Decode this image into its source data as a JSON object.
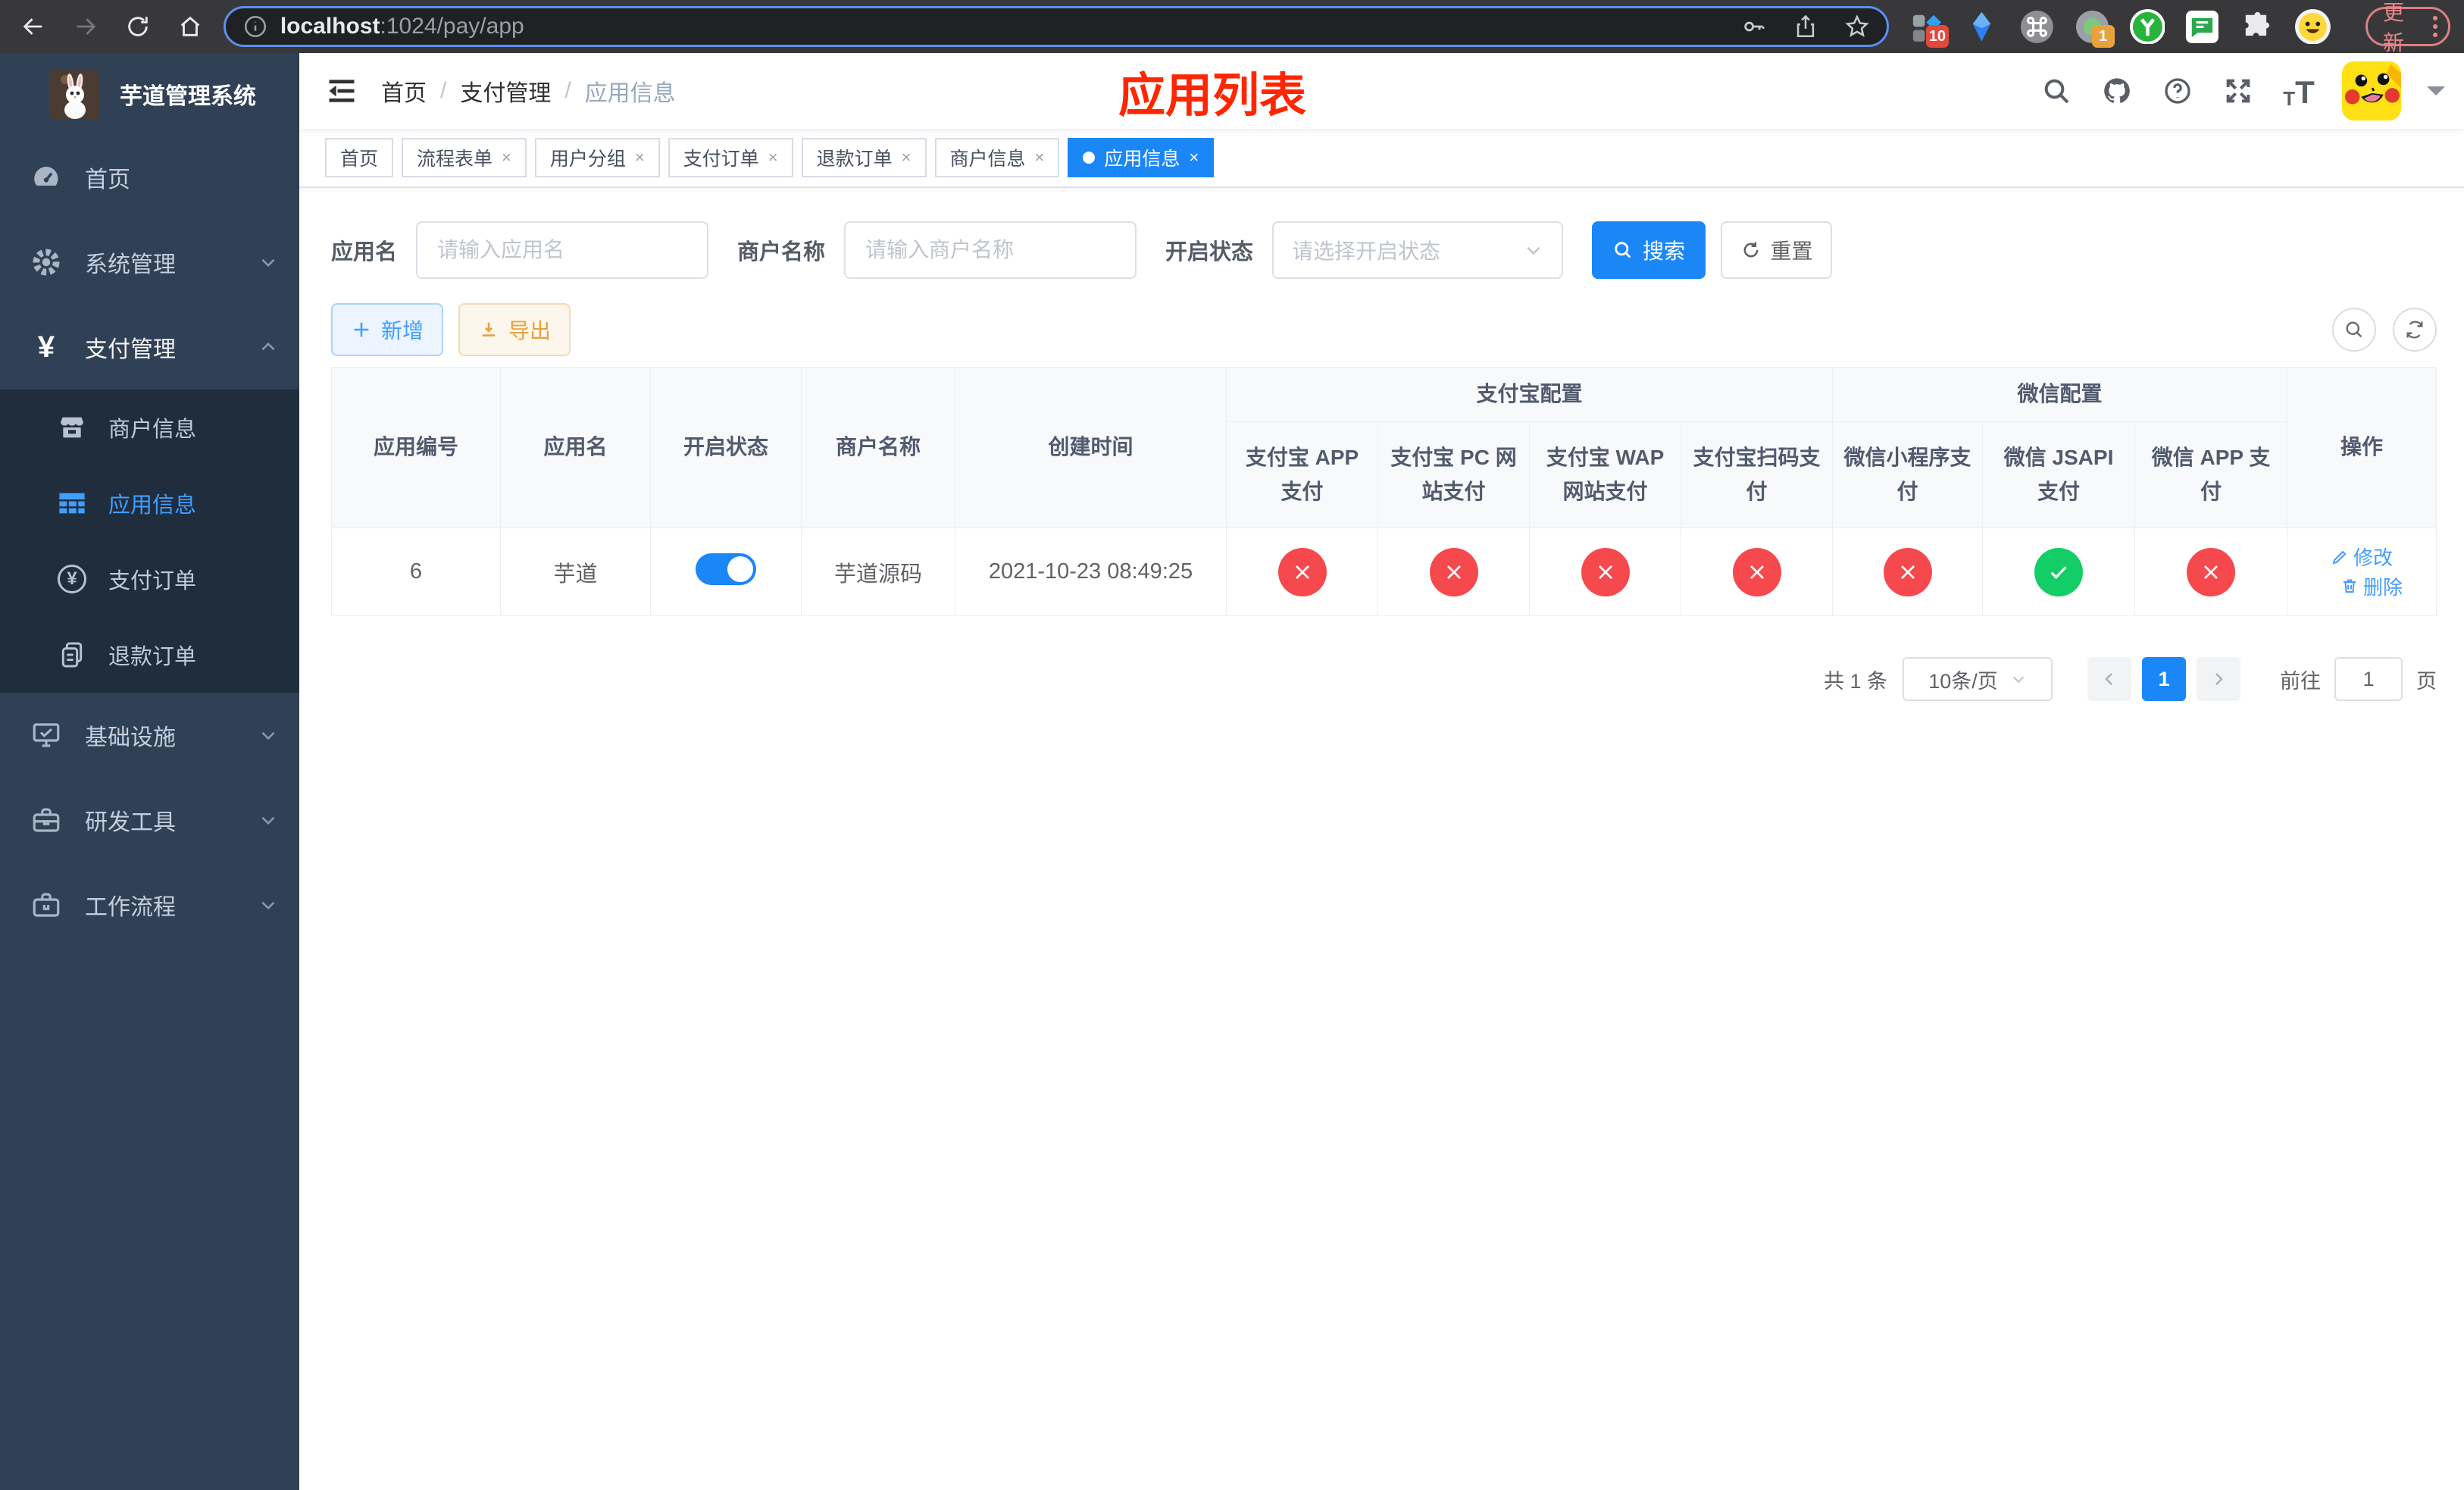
{
  "browser": {
    "url_host": "localhost",
    "url_path": ":1024/pay/app",
    "update_button": "更新",
    "ext_badge_a": "10",
    "ext_badge_b": "1"
  },
  "sidebar": {
    "logo_title": "芋道管理系统",
    "items": [
      {
        "label": "首页"
      },
      {
        "label": "系统管理"
      },
      {
        "label": "支付管理"
      },
      {
        "label": "商户信息"
      },
      {
        "label": "应用信息"
      },
      {
        "label": "支付订单"
      },
      {
        "label": "退款订单"
      },
      {
        "label": "基础设施"
      },
      {
        "label": "研发工具"
      },
      {
        "label": "工作流程"
      }
    ]
  },
  "breadcrumb": {
    "items": [
      "首页",
      "支付管理",
      "应用信息"
    ]
  },
  "page_title": "应用列表",
  "tabs": [
    {
      "label": "首页"
    },
    {
      "label": "流程表单"
    },
    {
      "label": "用户分组"
    },
    {
      "label": "支付订单"
    },
    {
      "label": "退款订单"
    },
    {
      "label": "商户信息"
    },
    {
      "label": "应用信息"
    }
  ],
  "filters": {
    "app_name_label": "应用名",
    "app_name_placeholder": "请输入应用名",
    "merchant_label": "商户名称",
    "merchant_placeholder": "请输入商户名称",
    "status_label": "开启状态",
    "status_placeholder": "请选择开启状态",
    "search_button": "搜索",
    "reset_button": "重置"
  },
  "toolbar": {
    "add_button": "新增",
    "export_button": "导出"
  },
  "table": {
    "group_alipay": "支付宝配置",
    "group_wechat": "微信配置",
    "col_app_id": "应用编号",
    "col_app_name": "应用名",
    "col_status": "开启状态",
    "col_merchant": "商户名称",
    "col_created": "创建时间",
    "col_alipay_app": "支付宝 APP 支付",
    "col_alipay_pc": "支付宝 PC 网站支付",
    "col_alipay_wap": "支付宝 WAP 网站支付",
    "col_alipay_qr": "支付宝扫码支付",
    "col_wx_mini": "微信小程序支付",
    "col_wx_jsapi": "微信 JSAPI 支付",
    "col_wx_app": "微信 APP 支付",
    "col_actions": "操作",
    "row": {
      "app_id": "6",
      "app_name": "芋道",
      "status_on": true,
      "merchant": "芋道源码",
      "created": "2021-10-23 08:49:25",
      "channels": [
        "no",
        "no",
        "no",
        "no",
        "no",
        "yes",
        "no"
      ],
      "edit_link": "修改",
      "delete_link": "删除"
    }
  },
  "pagination": {
    "total_text": "共 1 条",
    "page_size": "10条/页",
    "current_page": "1",
    "goto_label": "前往",
    "goto_value": "1",
    "page_unit": "页"
  }
}
